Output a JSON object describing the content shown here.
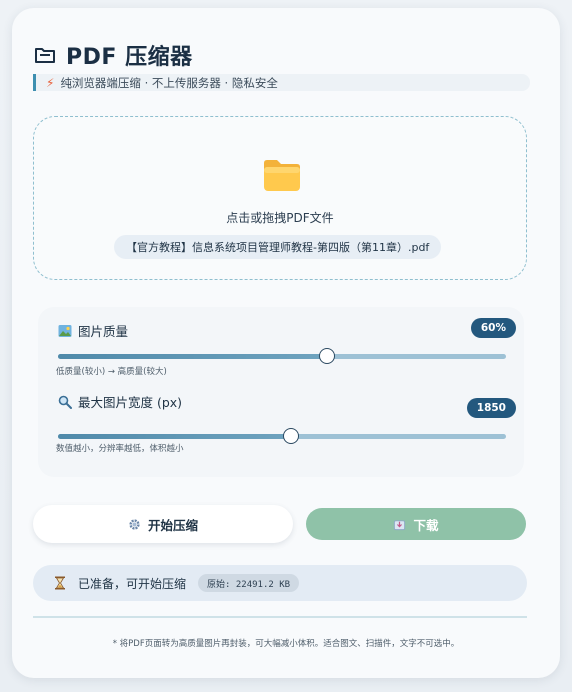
{
  "header": {
    "title": "PDF 压缩器",
    "title_icon": "folder-outline-icon",
    "subtitle_icon": "lightning-icon",
    "subtitle": "纯浏览器端压缩 · 不上传服务器 · 隐私安全"
  },
  "dropzone": {
    "icon": "folder-icon",
    "label": "点击或拖拽PDF文件",
    "file_name": "【官方教程】信息系统项目管理师教程-第四版（第11章）.pdf"
  },
  "settings": {
    "quality": {
      "icon": "picture-icon",
      "label": "图片质量",
      "value_text": "60%",
      "value": 0.6,
      "hint": "低质量(较小) → 高质量(较大)"
    },
    "max_width": {
      "icon": "magnifier-icon",
      "label": "最大图片宽度 (px)",
      "value_text": "1850",
      "value": 1850,
      "slider_fraction": 0.52,
      "hint": "数值越小，分辨率越低，体积越小"
    }
  },
  "actions": {
    "start_icon": "gear-icon",
    "start_label": "开始压缩",
    "download_icon": "download-box-icon",
    "download_label": "下载"
  },
  "status": {
    "icon": "hourglass-icon",
    "text": "已准备，可开始压缩",
    "original_size": "原始: 22491.2 KB"
  },
  "footnote": "* 将PDF页面转为高质量图片再封装，可大幅减小体积。适合图文、扫描件，文字不可选中。",
  "colors": {
    "accent": "#23587e",
    "slider_track": "#9dc1d5",
    "download_button": "#8fc2a8",
    "status_bg": "#e3ebf4"
  }
}
